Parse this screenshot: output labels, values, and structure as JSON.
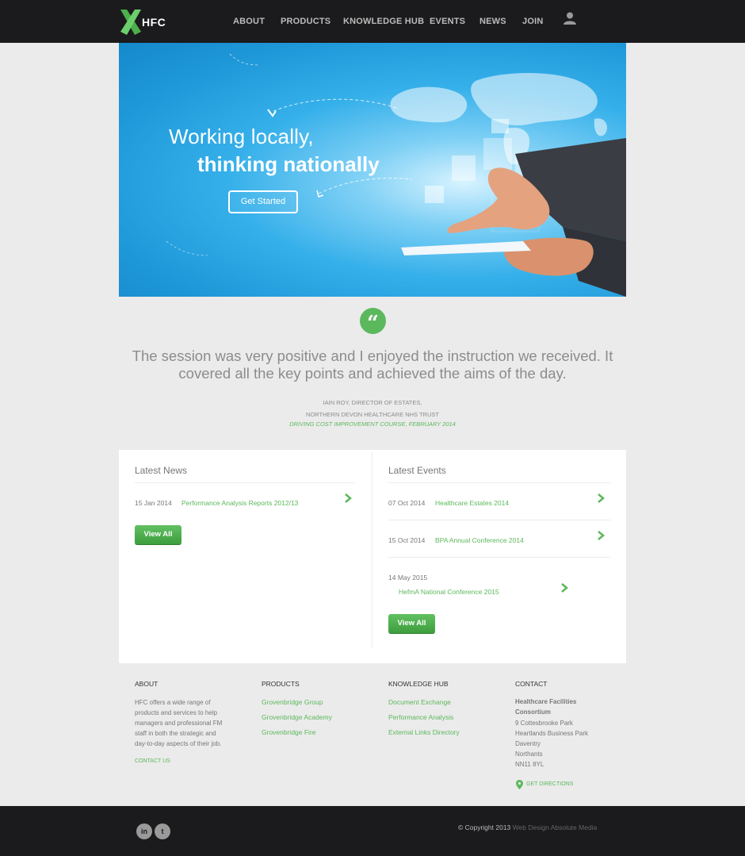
{
  "header": {
    "logo_text": "HFC",
    "nav": [
      "ABOUT",
      "PRODUCTS",
      "KNOWLEDGE HUB",
      "EVENTS",
      "NEWS",
      "JOIN"
    ],
    "user_icon": "user-icon"
  },
  "hero": {
    "line1": "Working locally,",
    "line2": "thinking nationally",
    "cta": "Get Started"
  },
  "testimonial": {
    "quote_mark": "“",
    "text": "The session was very positive and I enjoyed the instruction we received.  It covered all the key points and achieved the aims of the day.",
    "author_line1": "IAIN ROY, DIRECTOR OF ESTATES,",
    "author_line2": "NORTHERN DEVON HEALTHCARE NHS TRUST",
    "course": "DRIVING COST IMPROVEMENT COURSE, FEBRUARY 2014"
  },
  "news": {
    "title": "Latest News",
    "items": [
      {
        "date": "15 Jan 2014",
        "title": "Performance Analysis Reports 2012/13"
      }
    ],
    "view_all": "View All"
  },
  "events": {
    "title": "Latest Events",
    "items": [
      {
        "date": "07 Oct 2014",
        "title": "Healthcare Estates 2014"
      },
      {
        "date": "15 Oct 2014",
        "title": "BPA Annual Conference 2014"
      },
      {
        "date": "14 May 2015",
        "title": "HefmA National Conference 2015"
      }
    ],
    "view_all": "View All"
  },
  "footer": {
    "about": {
      "heading": "ABOUT",
      "lines": [
        "HFC offers a wide range of",
        "products and services to help",
        "managers and professional FM",
        "staff in both the strategic and",
        "day-to-day aspects of their job."
      ],
      "link": "CONTACT US"
    },
    "products": {
      "heading": "PRODUCTS",
      "links": [
        "Grovenbridge Group",
        "Grovenbridge Academy",
        "Grovenbridge Fire"
      ]
    },
    "knowledge_hub": {
      "heading": "KNOWLEDGE HUB",
      "links": [
        "Document Exchange",
        "Performance Analysis",
        "External Links Directory"
      ]
    },
    "contact": {
      "heading": "CONTACT",
      "org_line1": "Healthcare Facilities",
      "org_line2": "Consortium",
      "address": [
        "9 Cottesbrooke Park",
        "Heartlands Business Park",
        "Daventry",
        "Northants",
        "NN11 8YL"
      ],
      "directions": "GET DIRECTIONS"
    }
  },
  "bottom": {
    "social": [
      {
        "icon": "linkedin-icon",
        "glyph": "in"
      },
      {
        "icon": "twitter-icon",
        "glyph": "t"
      }
    ],
    "copyright": "© Copyright 2013",
    "credit": "Web Design Absolute Media"
  },
  "colors": {
    "accent": "#5cb85c",
    "dark": "#1b1a1c",
    "background": "#ebebeb"
  }
}
